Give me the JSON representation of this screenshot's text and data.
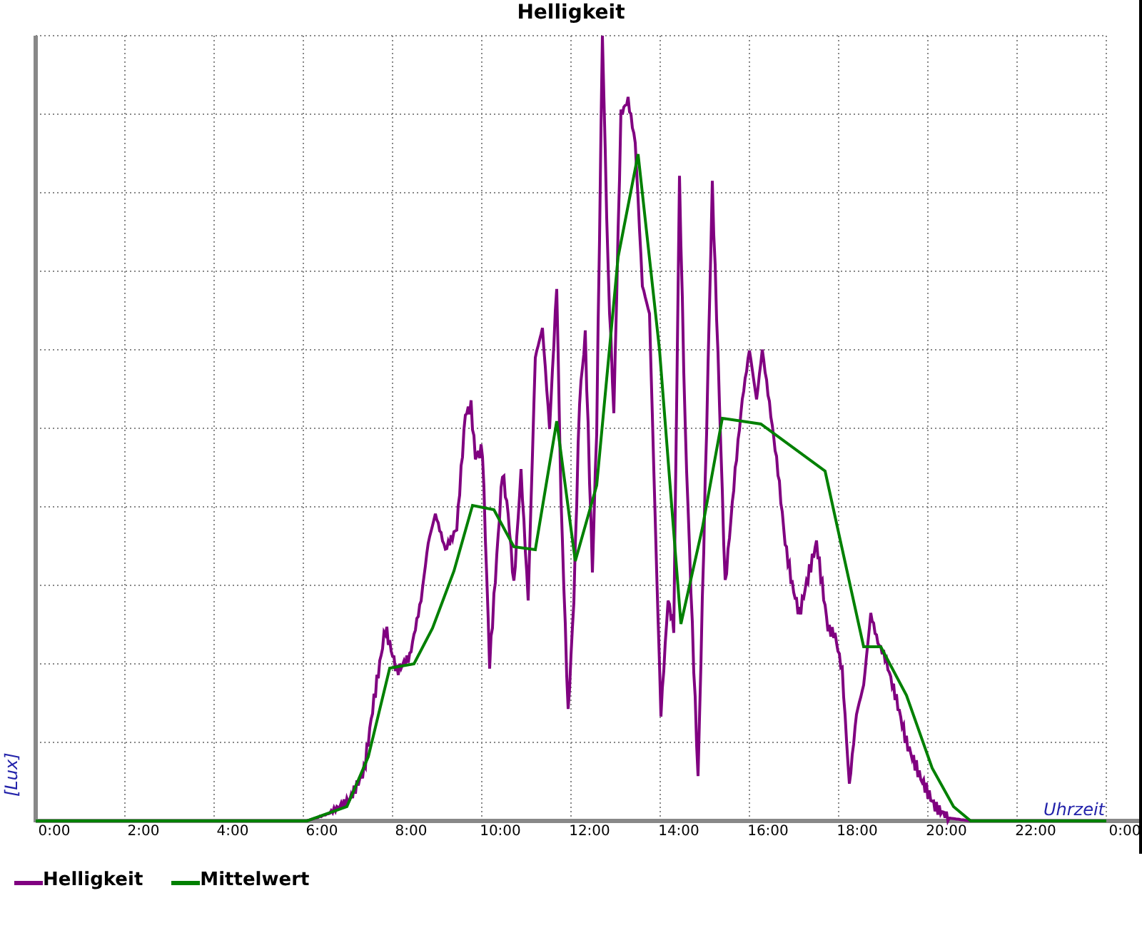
{
  "chart": {
    "title": "Helligkeit",
    "y_axis_label": "[Lux]",
    "x_axis_label": "Uhrzeit",
    "x_tick_labels": [
      "0:00",
      "2:00",
      "4:00",
      "6:00",
      "8:00",
      "10:00",
      "12:00",
      "14:00",
      "16:00",
      "18:00",
      "20:00",
      "22:00",
      "0:00"
    ],
    "legend": [
      {
        "label": "Helligkeit",
        "color": "#800080"
      },
      {
        "label": "Mittelwert",
        "color": "#008000"
      }
    ]
  }
}
